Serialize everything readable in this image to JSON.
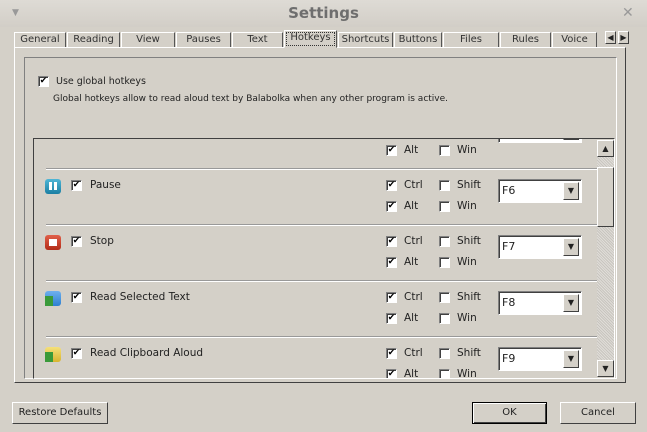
{
  "window": {
    "title": "Settings"
  },
  "tabs": [
    "General",
    "Reading",
    "View",
    "Pauses",
    "Text",
    "Hotkeys",
    "Shortcuts",
    "Buttons",
    "Files",
    "Rules",
    "Voice"
  ],
  "active_tab": "Hotkeys",
  "use_global": {
    "label": "Use global hotkeys",
    "checked": true,
    "description": "Global hotkeys allow to read aloud text by Balabolka when any other program is active."
  },
  "modifiers": {
    "ctrl": "Ctrl",
    "alt": "Alt",
    "shift": "Shift",
    "win": "Win"
  },
  "partial_row": {
    "alt": true,
    "win": false
  },
  "hotkeys": [
    {
      "name": "Pause",
      "icon": "pause-icon",
      "enabled": true,
      "ctrl": true,
      "alt": true,
      "shift": false,
      "win": false,
      "key": "F6"
    },
    {
      "name": "Stop",
      "icon": "stop-icon",
      "enabled": true,
      "ctrl": true,
      "alt": true,
      "shift": false,
      "win": false,
      "key": "F7"
    },
    {
      "name": "Read Selected Text",
      "icon": "read-selected-icon",
      "enabled": true,
      "ctrl": true,
      "alt": true,
      "shift": false,
      "win": false,
      "key": "F8"
    },
    {
      "name": "Read Clipboard Aloud",
      "icon": "read-clipboard-icon",
      "enabled": true,
      "ctrl": true,
      "alt": true,
      "shift": false,
      "win": false,
      "key": "F9"
    }
  ],
  "buttons": {
    "restore": "Restore Defaults",
    "ok": "OK",
    "cancel": "Cancel"
  },
  "check_glyph": "✔"
}
